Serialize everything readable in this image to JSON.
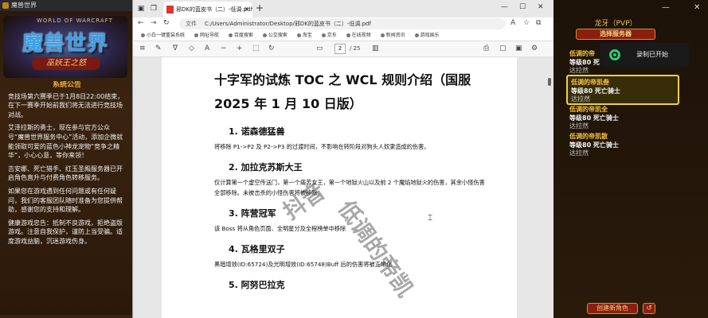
{
  "game_window": {
    "title": "魔兽世界",
    "logo_top": "WORLD OF WARCRAFT",
    "logo_main": "魔兽世界",
    "logo_sub": "巫妖王之怒",
    "notice": {
      "title": "系统公告",
      "paragraphs": [
        "竞技场第六赛季已于1月8日22:00结束，在下一赛季开始前我们将无法进行竞技场对战。",
        "艾泽拉斯的勇士，现在参与官方公众号“魔兽世界服务中心”活动，添加企微就能领取可爱的蓝色小神龙宠物“竞争之精华”，小心心意，等你来领！",
        "吉安娜、死亡猎手、红玉圣殿服务器已开启角色直升与付费角色转移服务。",
        "如果您在游戏遇到任何问题或有任何疑问，我们的客服团队随时准备为您提供帮助，感谢您的支持和理解。",
        "健康游戏忠告：抵制不良游戏，拒绝盗版游戏。注意自我保护，谨防上当受骗。适度游戏益脑，沉迷游戏伤身。"
      ]
    }
  },
  "browser": {
    "tab_title": "邪DK的蓝皮书（二）-低调.pdf",
    "address_label": "文件",
    "address": "C:/Users/Administrator/Desktop/邪DK的蓝皮书（二）-低调.pdf",
    "bookmarks": [
      "小白一键重装系统",
      "网址导航",
      "百度搜索",
      "公交搜索",
      "淘宝",
      "京东",
      "在线视频",
      "新闻资讯",
      "游戏娱乐"
    ],
    "page_current": "2",
    "page_total": "/ 25",
    "watermark_1": "抖音",
    "watermark_2": "低调的帝凯"
  },
  "document": {
    "title": "十字军的试炼 TOC 之 WCL 规则介绍（国服 2025 年 1 月 10 日版）",
    "sections": [
      {
        "heading": "1. 诺森德猛兽",
        "body": "将移除 P1->P2 及 P2->P3 的过渡时间，不影响在转阶段对狗头人奴隶造成的伤害。"
      },
      {
        "heading": "2. 加拉克苏斯大王",
        "body": "仅计算第一个虚空传送门，第一个痛苦女王，第一个地狱火山以及前 2 个魔焰地狱火的伤害，其余小怪伤害全部移除。未被击杀的小怪伤害将被移除。"
      },
      {
        "heading": "3. 阵营冠军",
        "body": "该 Boss 将从角色页面、全明星分及全程榜单中移除"
      },
      {
        "heading": "4. 瓦格里双子",
        "body": "黑暗增效(ID:65724)及光明增效(ID:65748)Buff 后的伤害将被正常化"
      },
      {
        "heading": "5. 阿努巴拉克",
        "body": ""
      }
    ]
  },
  "character_select": {
    "realm": "龙牙（PVP）",
    "select_server_label": "选择服务器",
    "recording_label": "录制已开始",
    "characters": [
      {
        "name": "低调的帝",
        "level": "等级80 死",
        "status": "达拉然"
      },
      {
        "name": "低调的帝凯叁",
        "level": "等级80 死亡骑士",
        "status": "达拉然"
      },
      {
        "name": "低调的帝凯全",
        "level": "等级80 死亡骑士",
        "status": "达拉然"
      },
      {
        "name": "低调的帝凯散",
        "level": "等级80 死亡骑士",
        "status": "达拉然"
      }
    ],
    "create_button": "创建新角色",
    "back_button": "↺"
  }
}
